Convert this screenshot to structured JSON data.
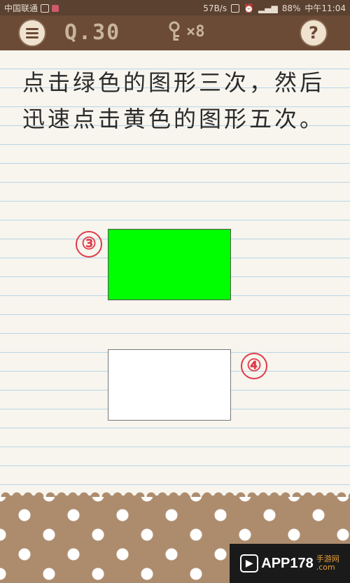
{
  "status_bar": {
    "carrier": "中国联通",
    "speed": "57B/s",
    "battery": "88%",
    "time": "中午11:04"
  },
  "header": {
    "question_label": "Q.30",
    "hint_count": "×8",
    "help_label": "?"
  },
  "instruction": "点击绿色的图形三次，然后迅速点击黄色的图形五次。",
  "shapes": {
    "green_color": "#00ff00",
    "white_color": "#ffffff",
    "annotation_green": "③",
    "annotation_white": "④"
  },
  "watermark": {
    "text": "APP178",
    "sub_top": "手游网",
    "sub_bottom": ".com"
  }
}
